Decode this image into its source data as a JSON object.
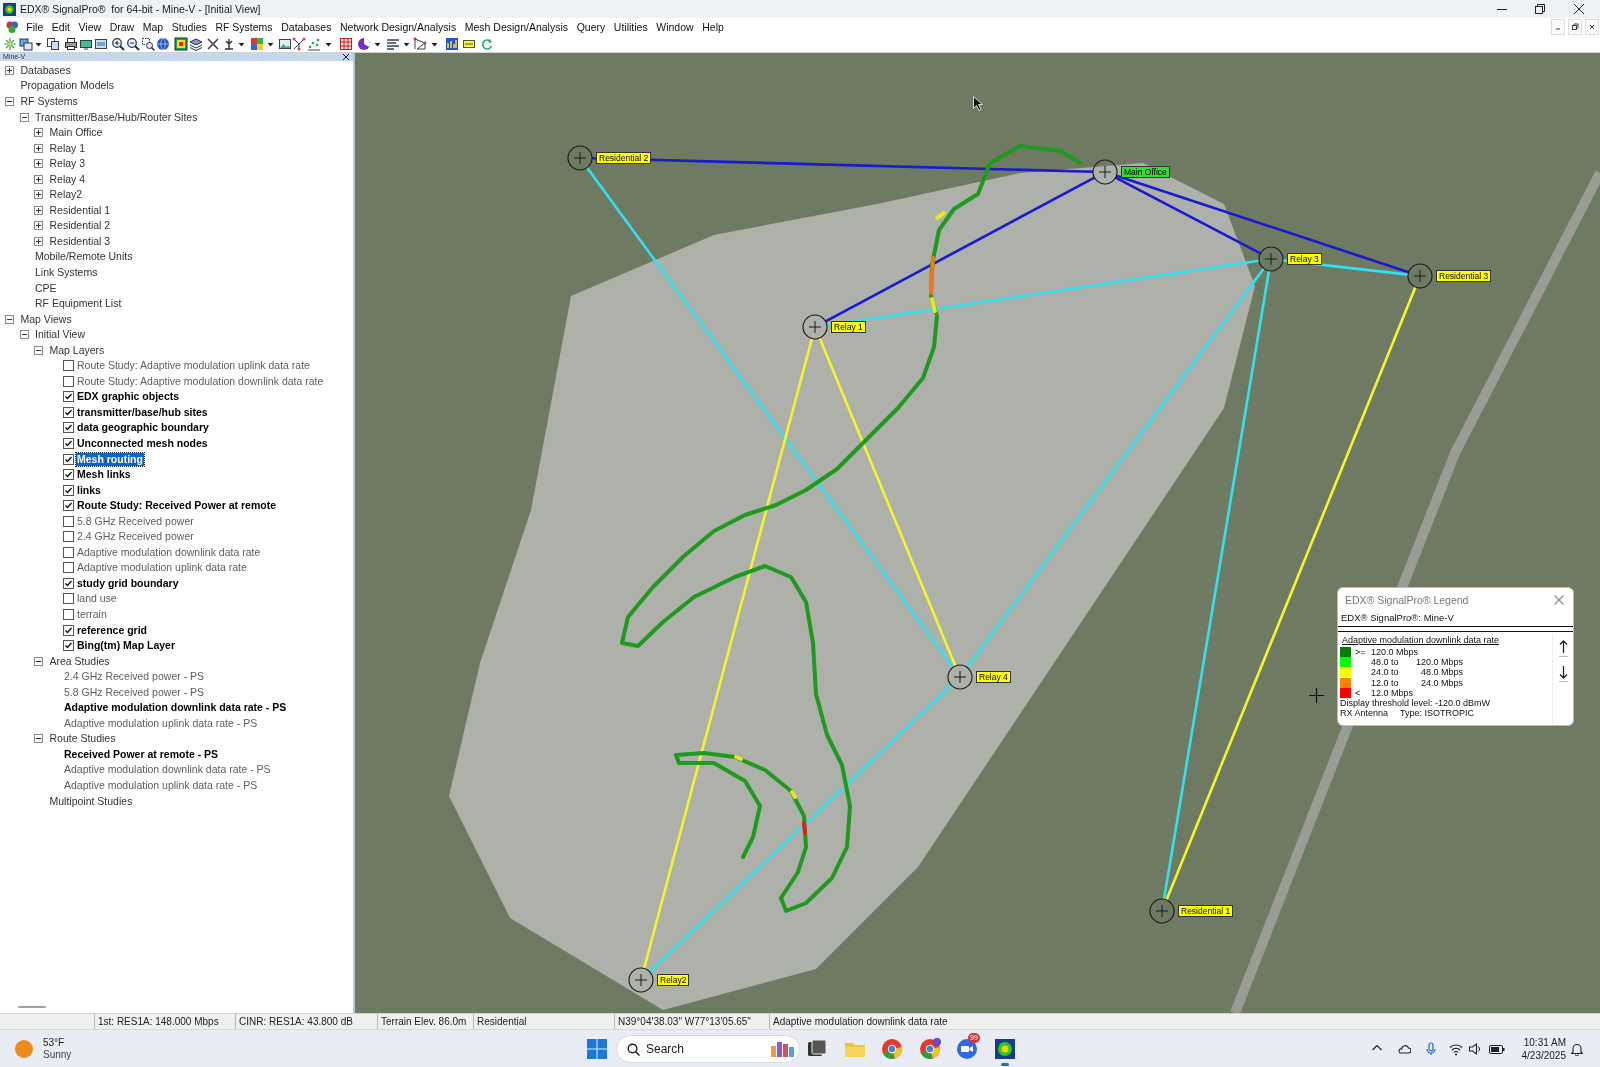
{
  "window": {
    "title": "EDX® SignalPro®  for 64-bit - Mine-V - [Initial View]"
  },
  "menu": [
    "File",
    "Edit",
    "View",
    "Draw",
    "Map",
    "Studies",
    "RF Systems",
    "Databases",
    "Network Design/Analysis",
    "Mesh Design/Analysis",
    "Query",
    "Utilities",
    "Window",
    "Help"
  ],
  "panel": {
    "title": "Mine-V",
    "tree": [
      {
        "label": "Databases",
        "expanded": false,
        "selected": false
      },
      {
        "label": "Propagation Models",
        "selected": false
      },
      {
        "label": "RF Systems",
        "expanded": true,
        "selected": false,
        "children": [
          {
            "label": "Transmitter/Base/Hub/Router Sites",
            "expanded": true,
            "selected": false,
            "children": [
              {
                "label": "Main Office",
                "expanded": false,
                "selected": false
              },
              {
                "label": "Relay 1",
                "expanded": false,
                "selected": false
              },
              {
                "label": "Relay 3",
                "expanded": false,
                "selected": false
              },
              {
                "label": "Relay 4",
                "expanded": false,
                "selected": false
              },
              {
                "label": "Relay2",
                "expanded": false,
                "selected": false
              },
              {
                "label": "Residential 1",
                "expanded": false,
                "selected": false
              },
              {
                "label": "Residential 2",
                "expanded": false,
                "selected": false
              },
              {
                "label": "Residential 3",
                "expanded": false,
                "selected": false
              }
            ]
          },
          {
            "label": "Mobile/Remote Units",
            "selected": false
          },
          {
            "label": "Link Systems",
            "selected": false
          },
          {
            "label": "CPE",
            "selected": false
          },
          {
            "label": "RF Equipment List",
            "selected": false
          }
        ]
      },
      {
        "label": "Map Views",
        "expanded": true,
        "selected": false,
        "children": [
          {
            "label": "Initial View",
            "expanded": true,
            "selected": false,
            "children": [
              {
                "label": "Map Layers",
                "expanded": true,
                "selected": false,
                "children": [
                  {
                    "label": "Route Study: Adaptive modulation uplink data rate",
                    "checked": false,
                    "selected": false
                  },
                  {
                    "label": "Route Study: Adaptive modulation downlink data rate",
                    "checked": false,
                    "selected": false
                  },
                  {
                    "label": "EDX graphic objects",
                    "checked": true,
                    "selected": false
                  },
                  {
                    "label": "transmitter/base/hub sites",
                    "checked": true,
                    "selected": false
                  },
                  {
                    "label": "data geographic boundary",
                    "checked": true,
                    "selected": false
                  },
                  {
                    "label": "Unconnected mesh nodes",
                    "checked": true,
                    "selected": false
                  },
                  {
                    "label": "Mesh routing",
                    "checked": true,
                    "selected": true
                  },
                  {
                    "label": "Mesh links",
                    "checked": true,
                    "selected": false
                  },
                  {
                    "label": "links",
                    "checked": true,
                    "selected": false
                  },
                  {
                    "label": "Route Study: Received Power at remote",
                    "checked": true,
                    "selected": false
                  },
                  {
                    "label": "5.8 GHz Received power",
                    "checked": false,
                    "selected": false
                  },
                  {
                    "label": "2.4 GHz Received power",
                    "checked": false,
                    "selected": false
                  },
                  {
                    "label": "Adaptive modulation downlink data rate",
                    "checked": false,
                    "selected": false
                  },
                  {
                    "label": "Adaptive modulation uplink data rate",
                    "checked": false,
                    "selected": false
                  },
                  {
                    "label": "study grid boundary",
                    "checked": true,
                    "selected": false
                  },
                  {
                    "label": "land use",
                    "checked": false,
                    "selected": false
                  },
                  {
                    "label": "terrain",
                    "checked": false,
                    "selected": false
                  },
                  {
                    "label": "reference grid",
                    "checked": true,
                    "selected": false
                  },
                  {
                    "label": "Bing(tm) Map Layer",
                    "checked": true,
                    "selected": false
                  }
                ]
              },
              {
                "label": "Area Studies",
                "expanded": true,
                "selected": false,
                "children": [
                  {
                    "label": "2.4 GHz Received power - PS",
                    "active": false,
                    "selected": false
                  },
                  {
                    "label": "5.8 GHz Received power - PS",
                    "active": false,
                    "selected": false
                  },
                  {
                    "label": "Adaptive modulation downlink data rate - PS",
                    "active": true,
                    "selected": false
                  },
                  {
                    "label": "Adaptive modulation uplink data rate - PS",
                    "active": false,
                    "selected": false
                  }
                ]
              },
              {
                "label": "Route Studies",
                "expanded": true,
                "selected": false,
                "children": [
                  {
                    "label": "Received Power at remote - PS",
                    "active": true,
                    "selected": false
                  },
                  {
                    "label": "Adaptive modulation downlink data rate - PS",
                    "active": false,
                    "selected": false
                  },
                  {
                    "label": "Adaptive modulation uplink data rate - PS",
                    "active": false,
                    "selected": false
                  }
                ]
              },
              {
                "label": "Multipoint Studies",
                "selected": false
              }
            ]
          }
        ]
      }
    ]
  },
  "map": {
    "sites": [
      {
        "label": "Residential 2",
        "color": "#ffff00"
      },
      {
        "label": "Main Office",
        "color": "#33dd33"
      },
      {
        "label": "Relay 3",
        "color": "#ffff00"
      },
      {
        "label": "Residential 3",
        "color": "#ffff00"
      },
      {
        "label": "Relay 1",
        "color": "#ffff00"
      },
      {
        "label": "Relay 4",
        "color": "#ffff00"
      },
      {
        "label": "Relay2",
        "color": "#ffff00"
      },
      {
        "label": "Residential 1",
        "color": "#ffff00"
      }
    ],
    "links": [
      {
        "color": "#1a1ad0"
      },
      {
        "color": "#1a1ad0"
      },
      {
        "color": "#1a1ad0"
      },
      {
        "color": "#1a1ad0"
      },
      {
        "color": "#33e0f0"
      },
      {
        "color": "#33e0f0"
      },
      {
        "color": "#33e0f0"
      },
      {
        "color": "#33e0f0"
      },
      {
        "color": "#33e0f0"
      },
      {
        "color": "#33e0f0"
      },
      {
        "color": "#f5f52a"
      },
      {
        "color": "#f5f52a"
      },
      {
        "color": "#f5f52a"
      }
    ],
    "legend": {
      "title": "EDX® SignalPro® Legend",
      "subtitle": "EDX® SignalPro®: Mine-V",
      "heading": "Adaptive modulation downlink data rate",
      "rows": [
        {
          "color": "#008000",
          "symbol": ">=",
          "low": "120.0 Mbps"
        },
        {
          "color": "#00ff00",
          "low": "48.0 to",
          "high": "120.0 Mbps"
        },
        {
          "color": "#ffff00",
          "low": "24.0 to",
          "high": "48.0 Mbps"
        },
        {
          "color": "#ff8000",
          "low": "12.0 to",
          "high": "24.0 Mbps"
        },
        {
          "color": "#ff0000",
          "symbol": "<",
          "low": "12.0 Mbps"
        }
      ],
      "threshold": "Display threshold level: -120.0 dBmW",
      "antenna": "RX Antenna",
      "antenna_type": "Type: ISOTROPIC"
    }
  },
  "status_bar": [
    "1st: RES1A: 148.000 Mbps",
    "CINR: RES1A: 43.800 dB",
    "Terrain Elev. 86.0m",
    "Residential",
    "N39°04'38.03\" W77°13'05.65\"",
    "Adaptive modulation downlink data rate"
  ],
  "taskbar": {
    "weather": {
      "temperature": "53°F",
      "condition": "Sunny"
    },
    "search": {
      "placeholder": "Search"
    },
    "badge": "99",
    "clock": {
      "time": "10:31 AM",
      "date": "4/23/2025"
    }
  }
}
